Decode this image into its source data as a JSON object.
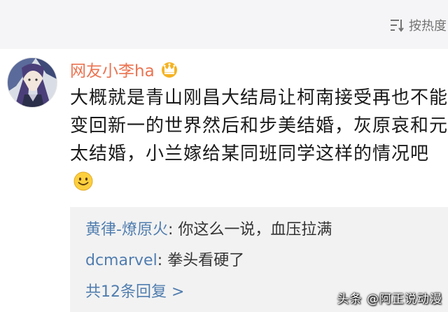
{
  "header": {
    "sort_label": "按热度"
  },
  "comment": {
    "username": "网友小李ha",
    "text": "大概就是青山刚昌大结局让柯南接受再也不能变回新一的世界然后和步美结婚，灰原哀和元太结婚，小兰嫁给某同班同学这样的情况吧"
  },
  "replies": [
    {
      "author": "黄律-燎原火",
      "text": "你这么一说，血压拉满"
    },
    {
      "author": "dcmarvel",
      "text": "拳头看硬了"
    }
  ],
  "more_replies": "共12条回复 >",
  "watermark": "头条 @阿正说动漫",
  "colors": {
    "username": "#eb7350",
    "link": "#507daf",
    "reply_background": "#f2f2f2",
    "top_bar": "#f5f5f7"
  }
}
